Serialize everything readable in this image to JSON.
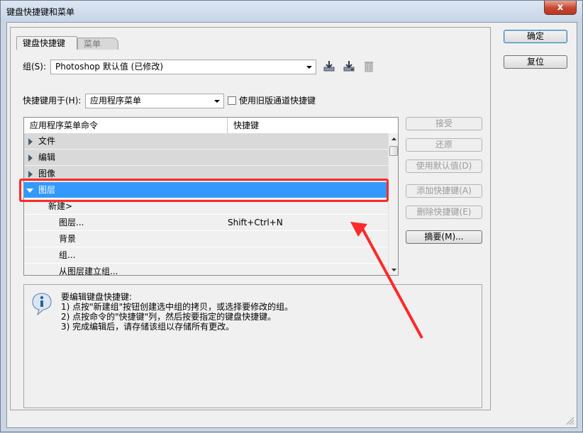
{
  "window": {
    "title": "键盘快捷键和菜单",
    "close_glyph": "x"
  },
  "tabs": [
    {
      "label": "键盘快捷键"
    },
    {
      "label": "菜单"
    }
  ],
  "set_row": {
    "label": "组(S):",
    "value": "Photoshop 默认值 (已修改)"
  },
  "for_row": {
    "label": "快捷键用于(H):",
    "value": "应用程序菜单",
    "checkbox_label": "使用旧版通道快捷键"
  },
  "table": {
    "headers": [
      "应用程序菜单命令",
      "快捷键"
    ],
    "rows": [
      {
        "label": "文件",
        "shortcut": ""
      },
      {
        "label": "编辑",
        "shortcut": ""
      },
      {
        "label": "图像",
        "shortcut": ""
      },
      {
        "label": "图层",
        "shortcut": ""
      },
      {
        "label": "新建>",
        "shortcut": ""
      },
      {
        "label": "图层...",
        "shortcut": "Shift+Ctrl+N"
      },
      {
        "label": "背景",
        "shortcut": ""
      },
      {
        "label": "组...",
        "shortcut": ""
      },
      {
        "label": "从图层建立组...",
        "shortcut": ""
      }
    ]
  },
  "side_buttons": {
    "accept": "接受",
    "undo": "还原",
    "use_default": "使用默认值(D)",
    "add": "添加快捷键(A)",
    "delete": "删除快捷键(E)",
    "summarize": "摘要(M)..."
  },
  "main_buttons": {
    "ok": "确定",
    "reset": "复位"
  },
  "help": {
    "heading": "要编辑键盘快捷键:",
    "lines": [
      "1) 点按\"新建组\"按钮创建选中组的拷贝，或选择要修改的组。",
      "2) 点按命令的\"快捷键\"列，然后按要指定的键盘快捷键。",
      "3) 完成编辑后，请存储该组以存储所有更改。"
    ]
  },
  "colors": {
    "selection": "#3399ff",
    "highlight": "#ff2a2a",
    "title_bg": "#dde7f3",
    "close_red": "#c8452e"
  },
  "icons": [
    "save-set-icon",
    "save-as-set-icon",
    "delete-set-icon",
    "info-icon",
    "expand-arrow-icon",
    "collapse-arrow-icon"
  ]
}
